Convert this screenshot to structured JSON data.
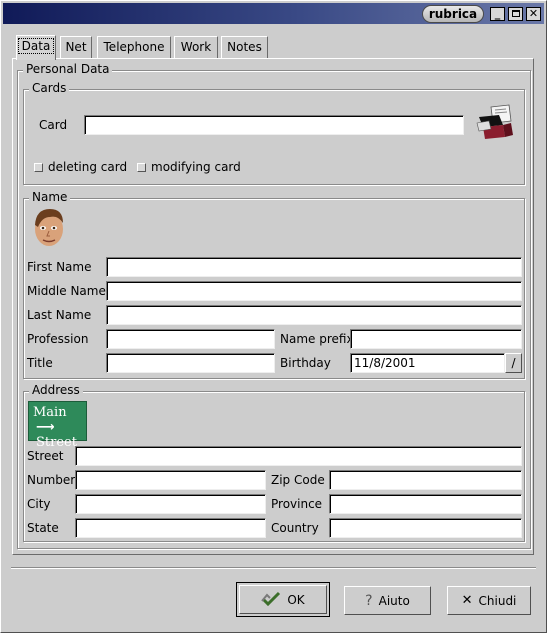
{
  "window": {
    "title": "rubrica",
    "buttons": [
      "minimize",
      "maximize",
      "close"
    ]
  },
  "tabs": [
    {
      "label": "Data",
      "active": true
    },
    {
      "label": "Net",
      "active": false
    },
    {
      "label": "Telephone",
      "active": false
    },
    {
      "label": "Work",
      "active": false
    },
    {
      "label": "Notes",
      "active": false
    }
  ],
  "personal": {
    "legend": "Personal Data",
    "cards": {
      "legend": "Cards",
      "card_label": "Card",
      "card_value": "",
      "icon": "card-file-icon",
      "deleting_label": "deleting card",
      "modifying_label": "modifying card"
    },
    "name": {
      "legend": "Name",
      "icon": "face-avatar-icon",
      "first_name_label": "First Name",
      "first_name_value": "",
      "middle_name_label": "Middle Name",
      "middle_name_value": "",
      "last_name_label": "Last Name",
      "last_name_value": "",
      "profession_label": "Profession",
      "profession_value": "",
      "name_prefix_label": "Name prefix",
      "name_prefix_value": "",
      "title_label": "Title",
      "title_value": "",
      "birthday_label": "Birthday",
      "birthday_value": "11/8/2001",
      "birthday_button": "/"
    },
    "address": {
      "legend": "Address",
      "sign_line1": "Main",
      "sign_line2": "Street",
      "sign_color": "#2e8a5a",
      "street_label": "Street",
      "street_value": "",
      "number_label": "Number",
      "number_value": "",
      "zip_label": "Zip Code",
      "zip_value": "",
      "city_label": "City",
      "city_value": "",
      "province_label": "Province",
      "province_value": "",
      "state_label": "State",
      "state_value": "",
      "country_label": "Country",
      "country_value": ""
    }
  },
  "footer": {
    "ok_label": "OK",
    "help_label": "Aiuto",
    "close_label": "Chiudi"
  }
}
